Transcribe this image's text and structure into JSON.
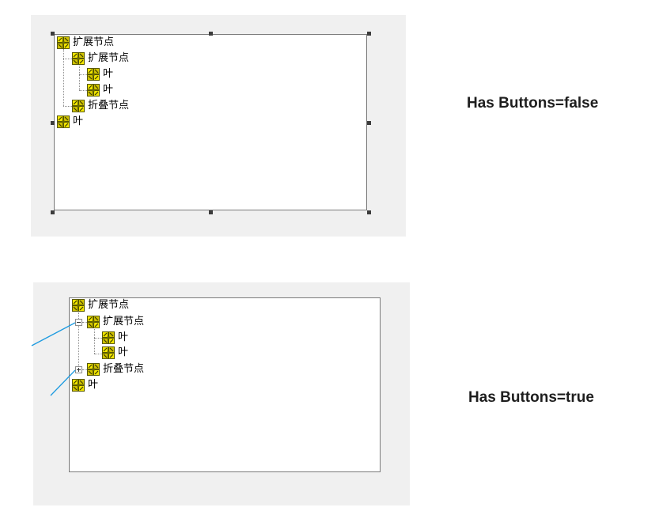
{
  "top_example": {
    "caption": "Has Buttons=false",
    "nodes": {
      "root": "扩展节点",
      "child_expanded": "扩展节点",
      "leaf_1": "叶",
      "leaf_2": "叶",
      "child_collapsed": "折叠节点",
      "root_leaf": "叶"
    }
  },
  "bottom_example": {
    "caption": "Has Buttons=true",
    "nodes": {
      "root": "扩展节点",
      "child_expanded": "扩展节点",
      "leaf_1": "叶",
      "leaf_2": "叶",
      "child_collapsed": "折叠节点",
      "root_leaf": "叶"
    },
    "expanders": [
      "minus",
      "plus"
    ]
  },
  "colors": {
    "panel": "#f0f0f0",
    "tree_border": "#7a7a7a",
    "callout_line": "#1e9be0",
    "node_icon_yellow": "#f2e600",
    "node_icon_dark": "#5a5a00"
  }
}
